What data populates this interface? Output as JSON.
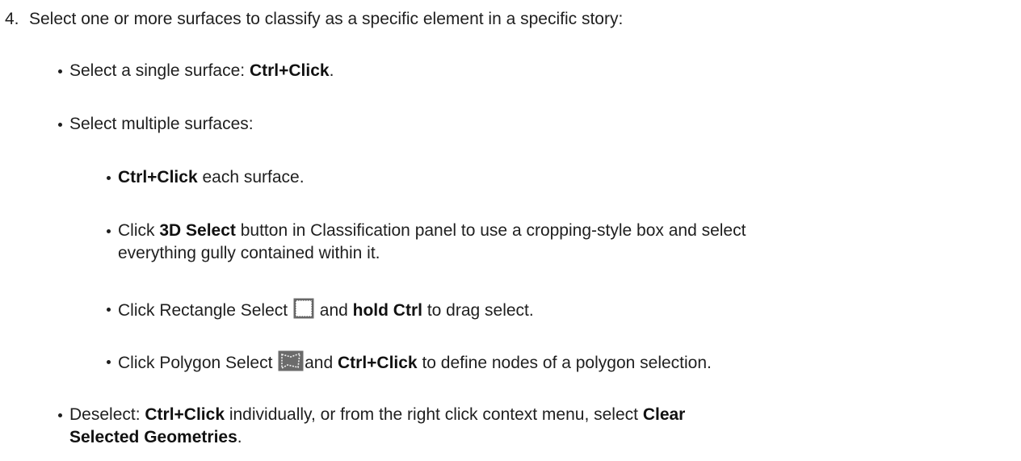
{
  "step": {
    "number": "4.",
    "text": "Select one or more surfaces to classify as a specific element in a specific story:"
  },
  "bullets": {
    "single": {
      "lead": "Select a single surface: ",
      "bold": "Ctrl+Click",
      "tail": "."
    },
    "multiple": {
      "lead": "Select multiple surfaces:"
    },
    "sub_ctrl_click": {
      "bold": "Ctrl+Click",
      "tail": " each surface."
    },
    "sub_3d_select": {
      "lead": "Click ",
      "bold": "3D Select",
      "tail_line1": " button in Classification panel to use a cropping-style box and select",
      "line2": "everything gully contained within it."
    },
    "sub_rectangle": {
      "lead": "Click Rectangle Select ",
      "icon": "rectangle-select-icon",
      "mid": " and ",
      "bold": "hold Ctrl",
      "tail": " to drag select."
    },
    "sub_polygon": {
      "lead": "Click Polygon Select ",
      "icon": "polygon-select-icon",
      "mid": " and ",
      "bold": "Ctrl+Click",
      "tail": " to define nodes of a polygon selection."
    },
    "deselect": {
      "lead": "Deselect: ",
      "bold1": "Ctrl+Click",
      "mid": " individually, or from the right click context menu, select ",
      "bold2_line1": "Clear",
      "bold2_line2": "Selected Geometries",
      "tail": "."
    }
  }
}
